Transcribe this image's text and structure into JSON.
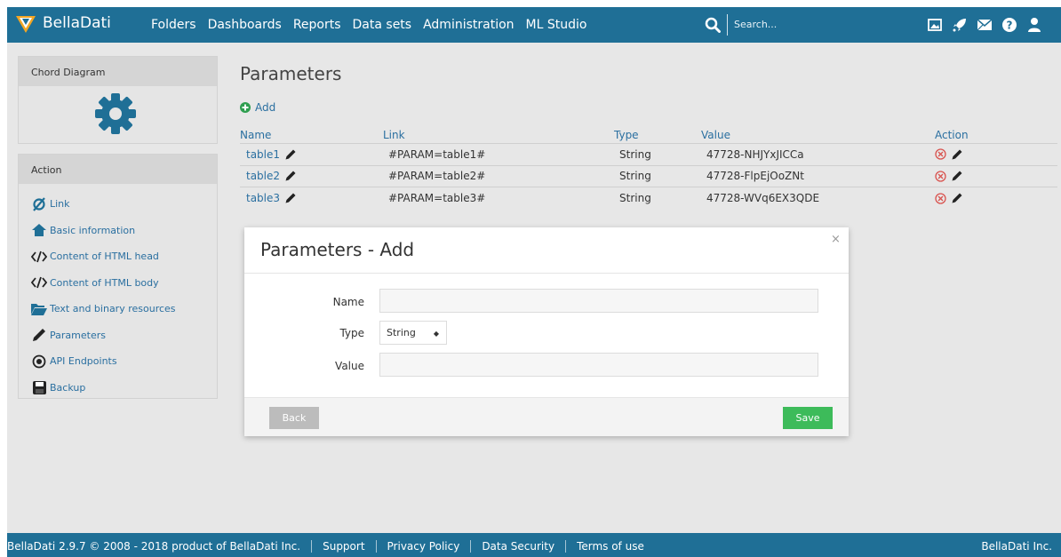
{
  "app": {
    "logo_text": "BellaDati"
  },
  "nav": {
    "items": [
      "Folders",
      "Dashboards",
      "Reports",
      "Data sets",
      "Administration",
      "ML Studio"
    ]
  },
  "search": {
    "placeholder": "Search..."
  },
  "top_icons": [
    "image-icon",
    "rocket-icon",
    "mail-icon",
    "help-icon",
    "user-icon"
  ],
  "sidebar": {
    "chord_title": "Chord Diagram",
    "action_title": "Action",
    "items": [
      {
        "label": "Link",
        "icon": "link-icon"
      },
      {
        "label": "Basic information",
        "icon": "home-icon"
      },
      {
        "label": "Content of HTML head",
        "icon": "code-icon"
      },
      {
        "label": "Content of HTML body",
        "icon": "code-icon"
      },
      {
        "label": "Text and binary resources",
        "icon": "folder-icon"
      },
      {
        "label": "Parameters",
        "icon": "pencil-icon"
      },
      {
        "label": "API Endpoints",
        "icon": "target-icon"
      },
      {
        "label": "Backup",
        "icon": "save-icon"
      }
    ]
  },
  "main": {
    "title": "Parameters",
    "add_label": "Add",
    "columns": {
      "name": "Name",
      "link": "Link",
      "type": "Type",
      "value": "Value",
      "action": "Action"
    },
    "rows": [
      {
        "name": "table1",
        "link": "#PARAM=table1#",
        "type": "String",
        "value": "47728-NHJYxJICCa"
      },
      {
        "name": "table2",
        "link": "#PARAM=table2#",
        "type": "String",
        "value": "47728-FlpEjOoZNt"
      },
      {
        "name": "table3",
        "link": "#PARAM=table3#",
        "type": "String",
        "value": "47728-WVq6EX3QDE"
      }
    ]
  },
  "modal": {
    "title": "Parameters - Add",
    "close": "×",
    "name_label": "Name",
    "name_value": "",
    "type_label": "Type",
    "type_selected": "String",
    "value_label": "Value",
    "value_value": "",
    "back_label": "Back",
    "save_label": "Save"
  },
  "footer": {
    "copyright": "BellaDati 2.9.7 © 2008 - 2018 product of BellaDati Inc.",
    "links": [
      "Support",
      "Privacy Policy",
      "Data Security",
      "Terms of use"
    ],
    "right": "BellaDati Inc."
  },
  "colors": {
    "nav_bg": "#1f6f96",
    "link": "#2a6fa0",
    "save": "#3dbb5a",
    "delete": "#d9534f"
  }
}
